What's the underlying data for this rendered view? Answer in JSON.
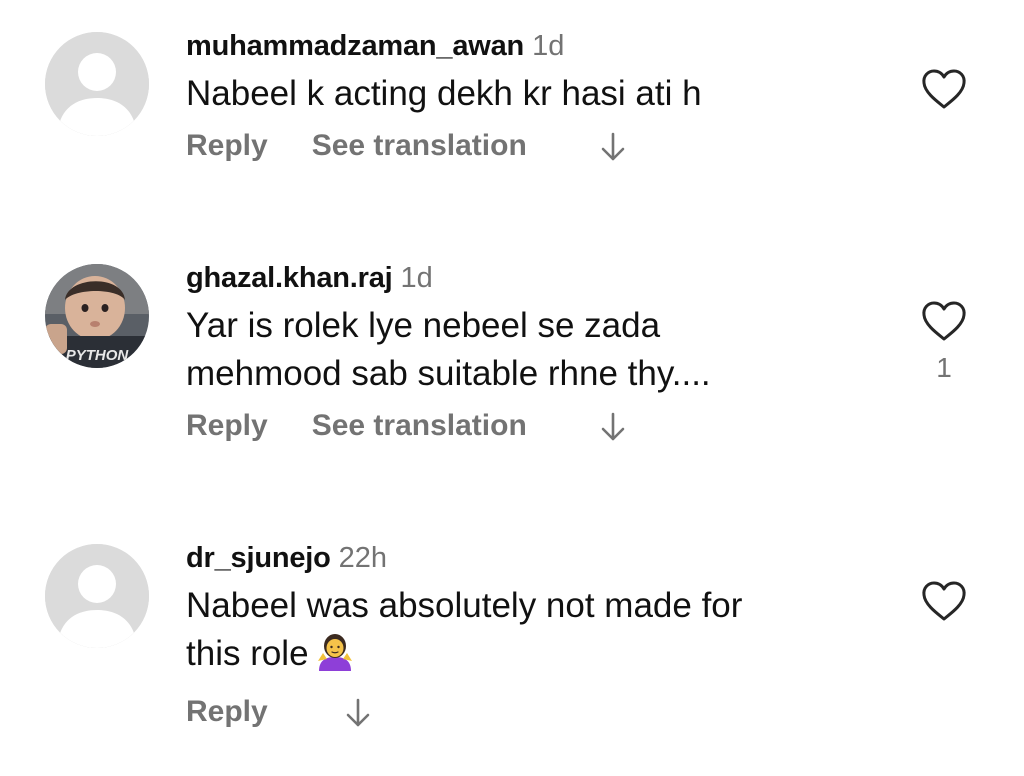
{
  "comments": [
    {
      "username": "muhammadzaman_awan",
      "time": "1d",
      "text_lines": [
        "Nabeel k acting dekh kr hasi ati h"
      ],
      "reply_label": "Reply",
      "translate_label": "See translation",
      "avatar": "default-avatar",
      "like_count": ""
    },
    {
      "username": "ghazal.khan.raj",
      "time": "1d",
      "text_lines": [
        "Yar is rolek lye nebeel se zada",
        "mehmood sab suitable rhne thy...."
      ],
      "reply_label": "Reply",
      "translate_label": "See translation",
      "avatar": "child-photo-avatar",
      "avatar_shirt_text": "PYTHON",
      "like_count": "1"
    },
    {
      "username": "dr_sjunejo",
      "time": "22h",
      "text_lines": [
        "Nabeel was absolutely not made for",
        "this role"
      ],
      "emoji": "person-shrugging-emoji",
      "reply_label": "Reply",
      "avatar": "default-avatar",
      "like_count": ""
    }
  ],
  "icons": {
    "like": "heart-outline-icon",
    "expand": "arrow-down-icon"
  },
  "colors": {
    "text": "#111111",
    "secondary": "#737373",
    "avatar_placeholder": "#dbdbdb"
  }
}
